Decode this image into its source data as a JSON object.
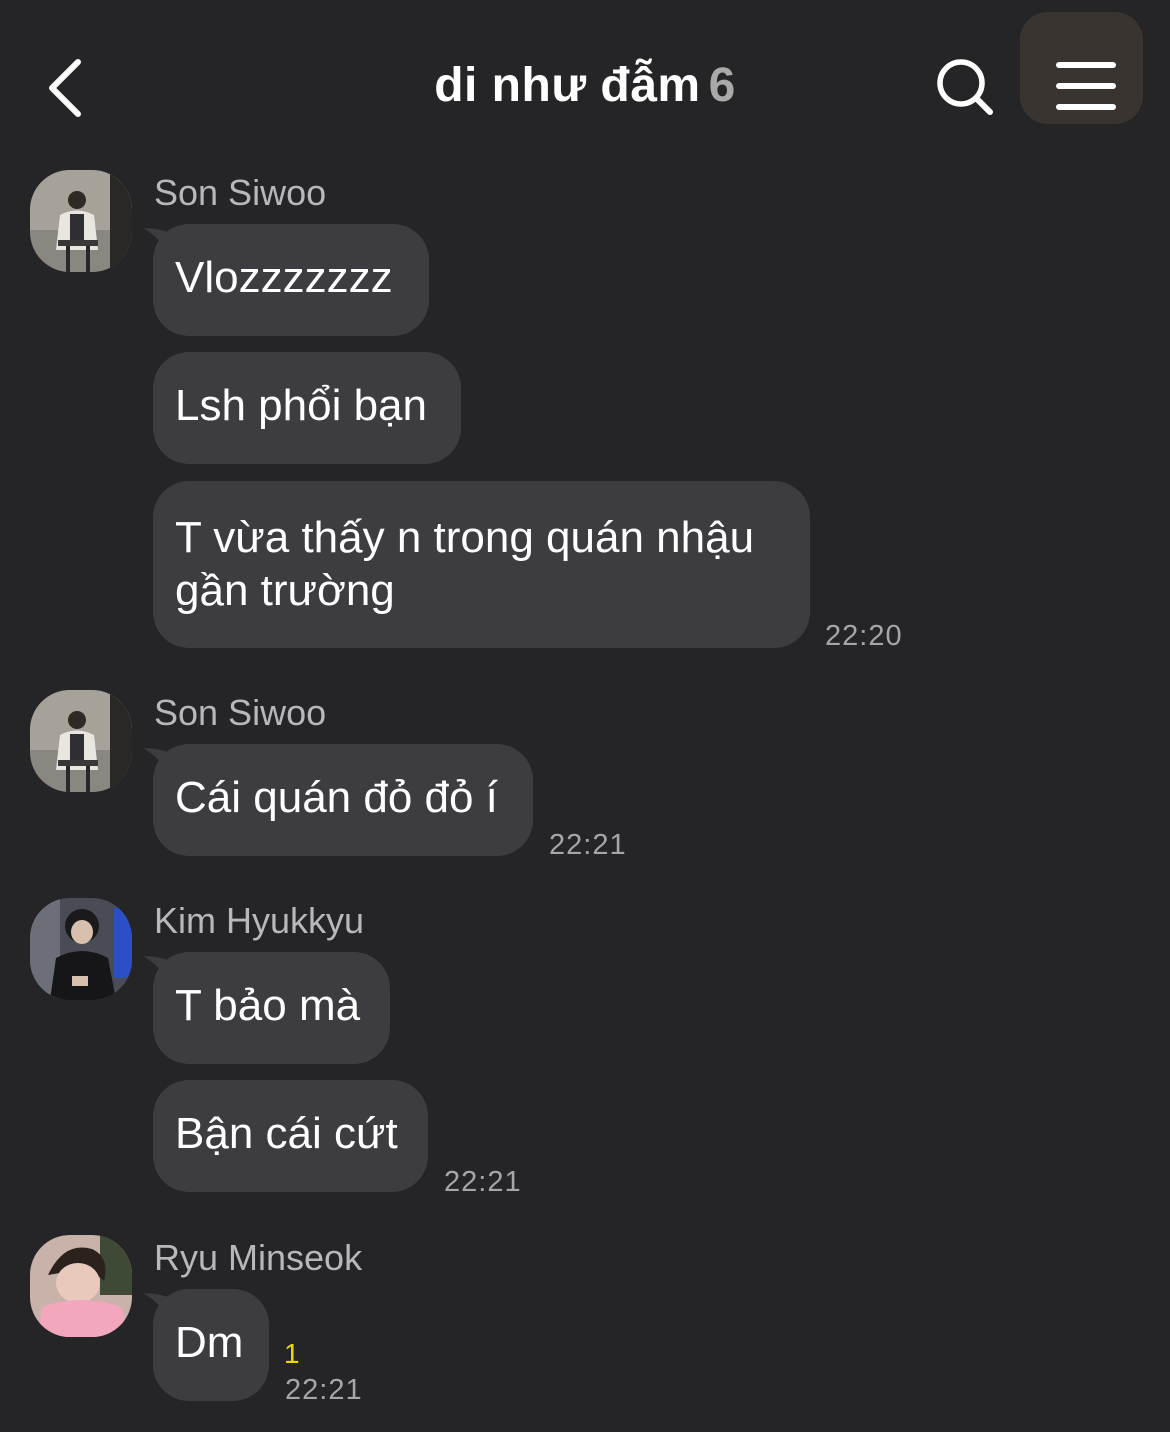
{
  "header": {
    "title": "di như đẫm",
    "member_count": "6",
    "back_icon": "chevron-left-icon",
    "search_icon": "search-icon",
    "menu_icon": "hamburger-menu-icon"
  },
  "messages": [
    {
      "sender": "Son Siwoo",
      "bubbles": [
        "Vlozzzzzzz",
        "Lsh phổi bạn",
        "T vừa thấy n trong quán nhậu gần trường"
      ],
      "time": "22:20"
    },
    {
      "sender": "Son Siwoo",
      "bubbles": [
        "Cái quán đỏ đỏ í"
      ],
      "time": "22:21"
    },
    {
      "sender": "Kim Hyukkyu",
      "bubbles": [
        "T bảo mà",
        "Bận cái cứt"
      ],
      "time": "22:21"
    },
    {
      "sender": "Ryu Minseok",
      "bubbles": [
        "Dm"
      ],
      "unread": "1",
      "time": "22:21"
    }
  ]
}
